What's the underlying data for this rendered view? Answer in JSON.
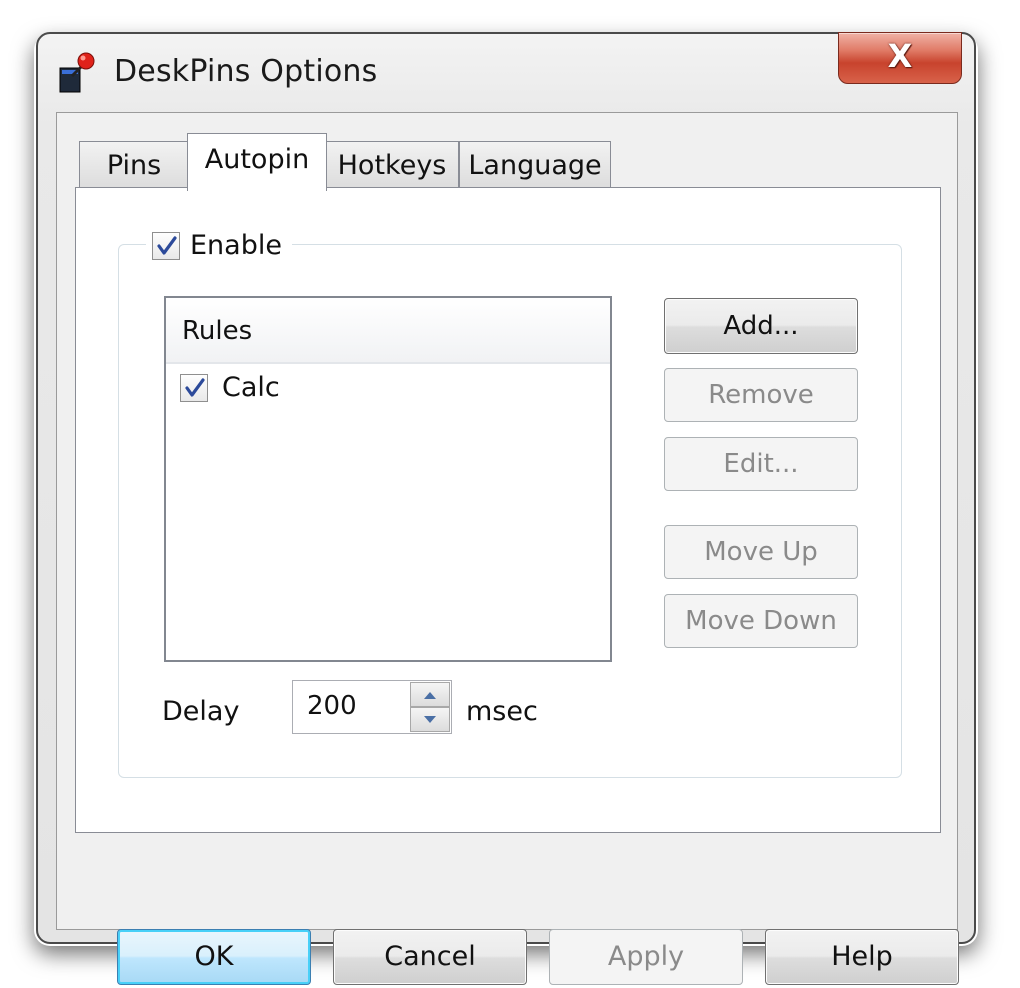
{
  "window": {
    "title": "DeskPins Options",
    "close_symbol": "X"
  },
  "tabs": [
    {
      "label": "Pins",
      "active": false
    },
    {
      "label": "Autopin",
      "active": true
    },
    {
      "label": "Hotkeys",
      "active": false
    },
    {
      "label": "Language",
      "active": false
    }
  ],
  "autopin": {
    "enable_label": "Enable",
    "enable_checked": true,
    "rules_header": "Rules",
    "rules": [
      {
        "label": "Calc",
        "checked": true
      }
    ],
    "buttons": {
      "add": "Add...",
      "remove": "Remove",
      "edit": "Edit...",
      "move_up": "Move Up",
      "move_down": "Move Down"
    },
    "delay_label": "Delay",
    "delay_value": "200",
    "delay_unit": "msec"
  },
  "dialog_buttons": {
    "ok": "OK",
    "cancel": "Cancel",
    "apply": "Apply",
    "help": "Help"
  },
  "colors": {
    "close_button": "#c8432d",
    "default_button_border": "#3c7fb1",
    "checkmark": "#2c4a9a"
  }
}
